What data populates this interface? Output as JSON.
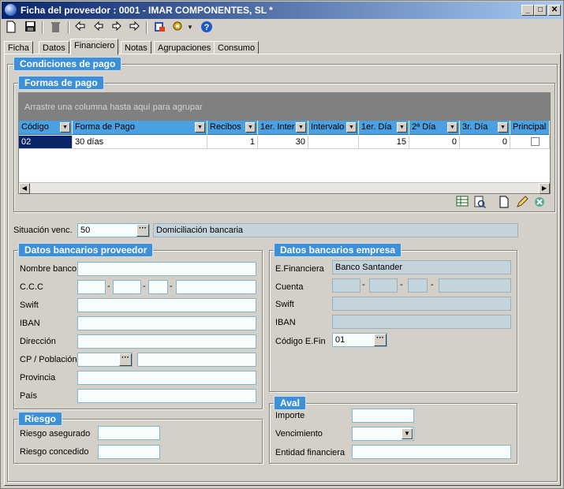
{
  "window": {
    "title": "Ficha del proveedor : 0001 - IMAR COMPONENTES, SL *",
    "buttons": {
      "minimize": "_",
      "maximize": "□",
      "close": "✕"
    }
  },
  "toolbar": {
    "icons": [
      "new-doc-icon",
      "save-icon",
      "delete-icon",
      "first-icon",
      "prev-icon",
      "next-icon",
      "last-icon",
      "report-icon",
      "tools-icon",
      "help-icon"
    ]
  },
  "tabs": [
    "Ficha",
    "Datos",
    "Financiero",
    "Notas",
    "Agrupaciones",
    "Consumo"
  ],
  "active_tab": "Financiero",
  "condiciones": {
    "title": "Condiciones de pago"
  },
  "formas": {
    "title": "Formas de pago",
    "group_hint": "Arrastre una columna hasta aquí para agrupar",
    "columns": [
      "Código",
      "Forma de Pago",
      "Recibos",
      "1er. Inter",
      "Intervalo",
      "1er. Día",
      "2ª Día",
      "3r. Día",
      "Principal"
    ],
    "rows": [
      {
        "codigo": "02",
        "forma": "30 días",
        "recibos": "1",
        "inter": "30",
        "intervalo": "",
        "dia1": "15",
        "dia2": "0",
        "dia3": "0"
      }
    ]
  },
  "situacion": {
    "label": "Situación venc.",
    "code": "50",
    "description": "Domiciliación bancaria"
  },
  "proveedor": {
    "title": "Datos bancarios proveedor",
    "nombre_banco": "Nombre banco",
    "ccc": "C.C.C",
    "swift": "Swift",
    "iban": "IBAN",
    "direccion": "Dirección",
    "cp": "CP / Población",
    "provincia": "Provincia",
    "pais": "País"
  },
  "empresa": {
    "title": "Datos bancarios empresa",
    "efinanciera_label": "E.Financiera",
    "efinanciera_value": "Banco Santander",
    "cuenta": "Cuenta",
    "swift": "Swift",
    "iban": "IBAN",
    "codigo_label": "Código E.Fin",
    "codigo_value": "01"
  },
  "riesgo": {
    "title": "Riesgo",
    "asegurado": "Riesgo asegurado",
    "concedido": "Riesgo concedido"
  },
  "aval": {
    "title": "Aval",
    "importe": "Importe",
    "vencimiento": "Vencimiento",
    "entidad": "Entidad financiera"
  },
  "dash": "-",
  "ellipsis": "···"
}
